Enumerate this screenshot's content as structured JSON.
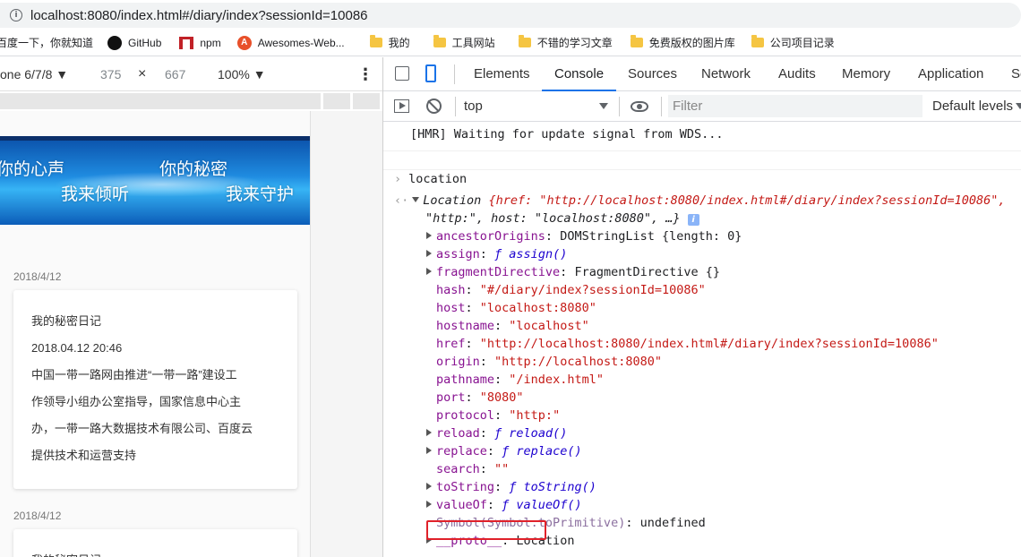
{
  "browser": {
    "url": "localhost:8080/index.html#/diary/index?sessionId=10086",
    "bookmarks": [
      "百度一下，你就知道",
      "GitHub",
      "npm",
      "Awesomes-Web...",
      "我的",
      "工具网站",
      "不错的学习文章",
      "免费版权的图片库",
      "公司项目记录"
    ]
  },
  "device_toolbar": {
    "device": "one 6/7/8 ▼",
    "width": "375",
    "times": "×",
    "height": "667",
    "zoom": "100% ▼",
    "more": "⋮"
  },
  "page": {
    "banner": [
      "你的心声",
      "我来倾听",
      "你的秘密",
      "我来守护"
    ],
    "entries": [
      {
        "date": "2018/4/12",
        "title": "我的秘密日记",
        "datetime": "2018.04.12 20:46",
        "body": [
          "中国一带一路网由推进“一带一路”建设工",
          "作领导小组办公室指导，国家信息中心主",
          "办，一带一路大数据技术有限公司、百度云",
          "提供技术和运营支持"
        ]
      },
      {
        "date": "2018/4/12",
        "title": "我的秘密日记"
      }
    ]
  },
  "devtools": {
    "tabs": [
      "Elements",
      "Console",
      "Sources",
      "Network",
      "Audits",
      "Memory",
      "Application",
      "Se"
    ],
    "active_tab": "Console",
    "context": "top",
    "filter_placeholder": "Filter",
    "levels": "Default levels",
    "console": {
      "hmr": "[HMR] Waiting for update signal from WDS...",
      "input": "location",
      "obj_class": "Location",
      "summary_1": "{href: \"http://localhost:8080/index.html#/diary/index?sessionId=10086\",",
      "summary_2": "\"http:\", host: \"localhost:8080\", …}",
      "props": [
        {
          "key": "ancestorOrigins",
          "val": "DOMStringList {length: 0}",
          "exp": true,
          "kind": "obj"
        },
        {
          "key": "assign",
          "val": "ƒ assign()",
          "exp": true,
          "kind": "fn"
        },
        {
          "key": "fragmentDirective",
          "val": "FragmentDirective {}",
          "exp": true,
          "kind": "obj"
        },
        {
          "key": "hash",
          "val": "\"#/diary/index?sessionId=10086\"",
          "exp": false,
          "kind": "str"
        },
        {
          "key": "host",
          "val": "\"localhost:8080\"",
          "exp": false,
          "kind": "str"
        },
        {
          "key": "hostname",
          "val": "\"localhost\"",
          "exp": false,
          "kind": "str"
        },
        {
          "key": "href",
          "val": "\"http://localhost:8080/index.html#/diary/index?sessionId=10086\"",
          "exp": false,
          "kind": "str"
        },
        {
          "key": "origin",
          "val": "\"http://localhost:8080\"",
          "exp": false,
          "kind": "str"
        },
        {
          "key": "pathname",
          "val": "\"/index.html\"",
          "exp": false,
          "kind": "str"
        },
        {
          "key": "port",
          "val": "\"8080\"",
          "exp": false,
          "kind": "str"
        },
        {
          "key": "protocol",
          "val": "\"http:\"",
          "exp": false,
          "kind": "str"
        },
        {
          "key": "reload",
          "val": "ƒ reload()",
          "exp": true,
          "kind": "fn"
        },
        {
          "key": "replace",
          "val": "ƒ replace()",
          "exp": true,
          "kind": "fn"
        },
        {
          "key": "search",
          "val": "\"\"",
          "exp": false,
          "kind": "str"
        },
        {
          "key": "toString",
          "val": "ƒ toString()",
          "exp": true,
          "kind": "fn"
        },
        {
          "key": "valueOf",
          "val": "ƒ valueOf()",
          "exp": true,
          "kind": "fn"
        },
        {
          "key": "Symbol(Symbol.toPrimitive)",
          "val": "undefined",
          "exp": false,
          "kind": "undef"
        },
        {
          "key": "__proto__",
          "val": "Location",
          "exp": true,
          "kind": "obj"
        }
      ]
    }
  }
}
